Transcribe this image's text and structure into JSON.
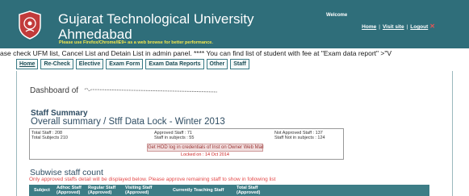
{
  "header": {
    "university_line1": "Gujarat Technological University",
    "university_line2": "Ahmedabad",
    "browser_note": "Please use Firefox/Chrome/IE9+ as a web browse for better performance.",
    "welcome": "Welcome",
    "links": {
      "home": "Home",
      "visit_site": "Visit site",
      "logout": "Logout",
      "separator": "|",
      "close_symbol": "✕"
    },
    "colors": {
      "background": "#2f6e7a",
      "note": "#f6e94e"
    }
  },
  "marquee": {
    "text": "ase check UFM list, Cancel List and Detain List in admin panel. **** You can find list of student with fee at \"Exam data report\" >\"V"
  },
  "nav": {
    "items": [
      {
        "label": "Home",
        "name": "nav-home"
      },
      {
        "label": "Re-Check",
        "name": "nav-recheck"
      },
      {
        "label": "Elective",
        "name": "nav-elective"
      },
      {
        "label": "Exam Form",
        "name": "nav-exam-form"
      },
      {
        "label": "Exam Data Reports",
        "name": "nav-exam-data-reports"
      },
      {
        "label": "Other",
        "name": "nav-other"
      },
      {
        "label": "Staff",
        "name": "nav-staff"
      }
    ]
  },
  "main": {
    "dashboard_label": "Dashboard of",
    "staff_summary": "Staff Summary",
    "overall_title": "Overall summary / Stff Data Lock - Winter 2013",
    "summary": {
      "total_staff": "Total Staff : 208",
      "total_subjects": "Total Subjects 210",
      "approved_staff": "Approved Staff : 71",
      "staff_in_subjects": "Staff in subjects : 55",
      "not_approved_staff": "Not Approved Staff : 137",
      "staff_not_in_subjects": "Staff Not in subjects : 124",
      "lock_button": "Get HOD log in credentials of Inst on Owner Web Mail",
      "locked_on": "Locked on : 14 Oct 2014"
    },
    "subwise_title": "Subwise staff count",
    "subwise_note": "Only approved staffs detail will be displayed below. Please approve remaining staff to show in following list",
    "table": {
      "headers": [
        {
          "l1": "Subject",
          "l2": ""
        },
        {
          "l1": "Adhoc Staff",
          "l2": "(Approved)"
        },
        {
          "l1": "Regular Staff",
          "l2": "(Approved)"
        },
        {
          "l1": "Visiting Staff",
          "l2": "(Approved)"
        },
        {
          "l1": "Currently Teaching Staff",
          "l2": ""
        },
        {
          "l1": "Total Staff",
          "l2": "(Approved)"
        }
      ]
    }
  }
}
